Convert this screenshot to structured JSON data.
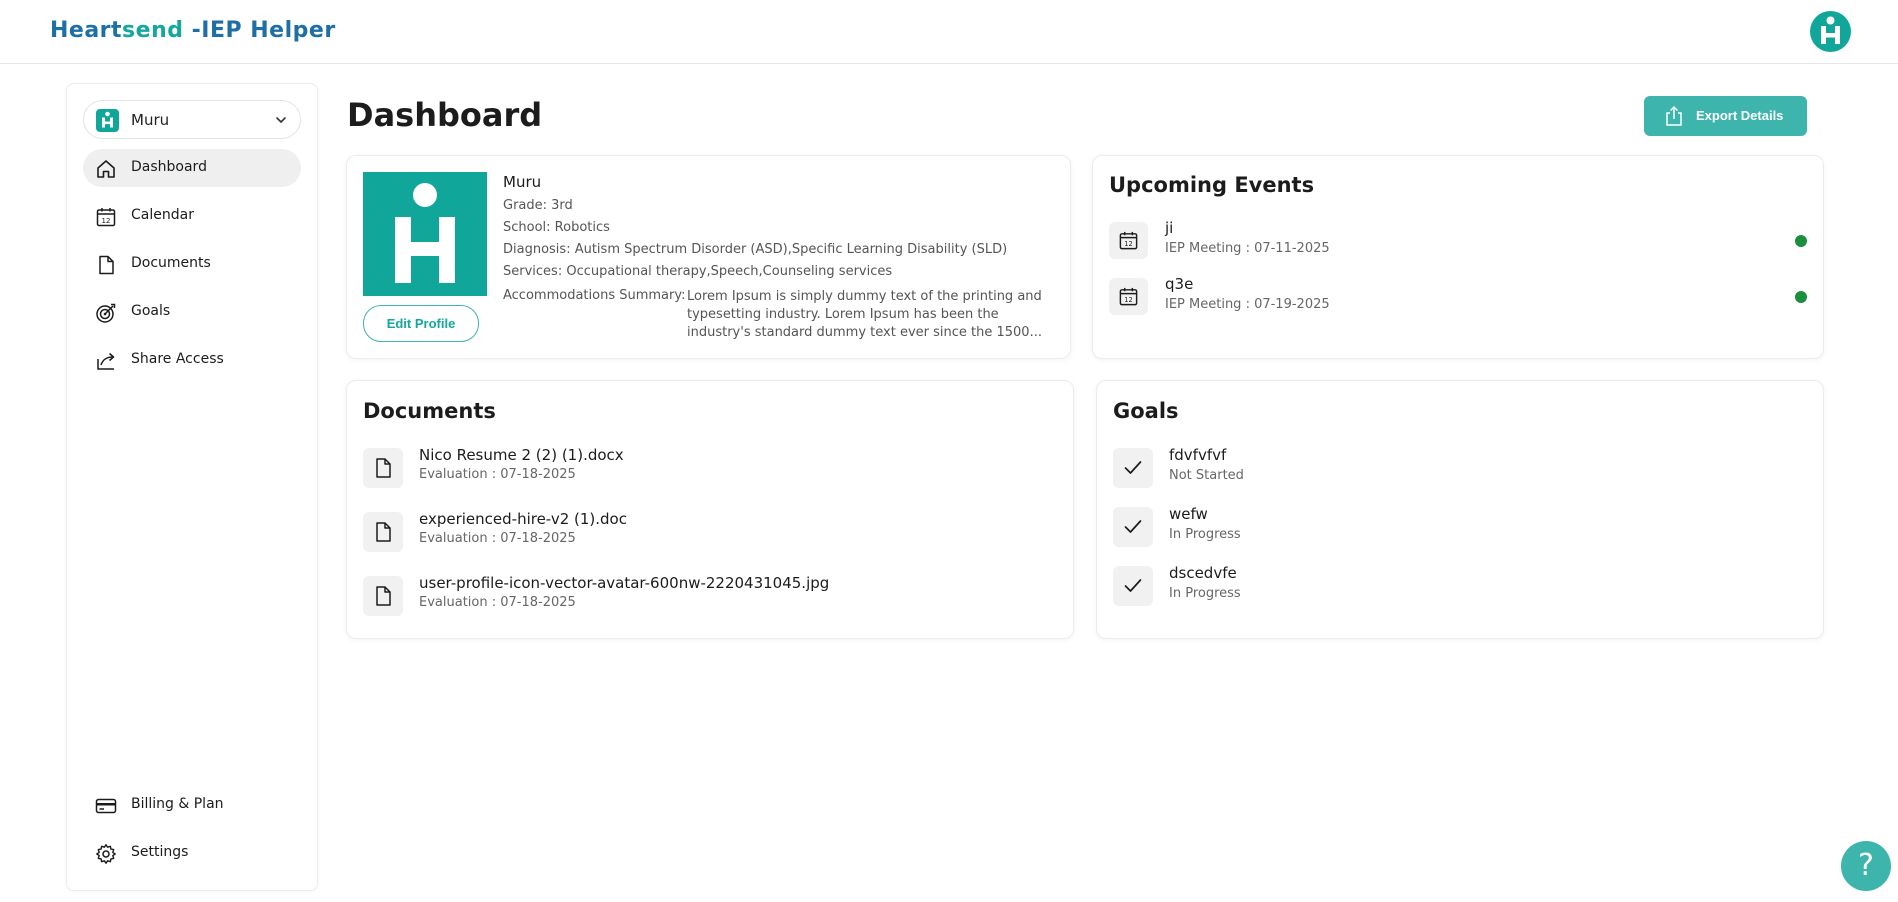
{
  "brand": {
    "part1": "Heart",
    "part2": "send",
    "part3": " -IEP Helper"
  },
  "sidebar": {
    "student": "Muru",
    "items": [
      {
        "label": "Dashboard",
        "icon": "home-icon"
      },
      {
        "label": "Calendar",
        "icon": "calendar-icon"
      },
      {
        "label": "Documents",
        "icon": "document-icon"
      },
      {
        "label": "Goals",
        "icon": "target-icon"
      },
      {
        "label": "Share Access",
        "icon": "share-icon"
      }
    ],
    "bottom_items": [
      {
        "label": "Billing & Plan",
        "icon": "credit-card-icon"
      },
      {
        "label": "Settings",
        "icon": "gear-icon"
      }
    ]
  },
  "header": {
    "title": "Dashboard",
    "export_label": "Export Details"
  },
  "profile": {
    "name": "Muru",
    "grade": "Grade: 3rd",
    "school": "School: Robotics",
    "diagnosis": "Diagnosis: Autism Spectrum Disorder (ASD),Specific Learning Disability (SLD)",
    "services": "Services: Occupational therapy,Speech,Counseling services",
    "accommodations_label": "Accommodations Summary:",
    "accommodations_text": "Lorem Ipsum is simply dummy text of the printing and typesetting industry. Lorem Ipsum has been the industry's standard dummy text ever since the 1500...",
    "edit_label": "Edit Profile"
  },
  "events": {
    "title": "Upcoming Events",
    "items": [
      {
        "title": "ji",
        "sub": "IEP Meeting : 07-11-2025"
      },
      {
        "title": "q3e",
        "sub": "IEP Meeting : 07-19-2025"
      }
    ]
  },
  "documents": {
    "title": "Documents",
    "items": [
      {
        "title": "Nico Resume 2 (2) (1).docx",
        "sub": "Evaluation : 07-18-2025"
      },
      {
        "title": "experienced-hire-v2 (1).doc",
        "sub": "Evaluation : 07-18-2025"
      },
      {
        "title": "user-profile-icon-vector-avatar-600nw-2220431045.jpg",
        "sub": "Evaluation : 07-18-2025"
      }
    ]
  },
  "goals": {
    "title": "Goals",
    "items": [
      {
        "title": "fdvfvfvf",
        "sub": "Not Started"
      },
      {
        "title": "wefw",
        "sub": "In Progress"
      },
      {
        "title": "dscedvfe",
        "sub": "In Progress"
      }
    ]
  },
  "help": {
    "label": "?"
  },
  "colors": {
    "accent": "#10a79a",
    "button": "#3db5ac",
    "brand_blue": "#1d6fa5",
    "status_green": "#1a8f3e"
  }
}
